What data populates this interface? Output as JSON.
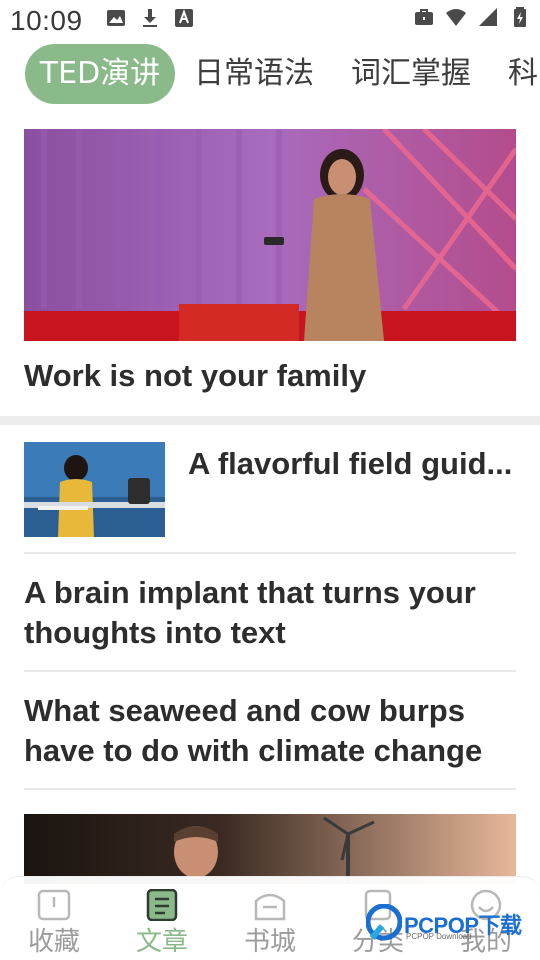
{
  "status_bar": {
    "time": "10:09",
    "left_icons": [
      "image-icon",
      "download-icon",
      "a-box-icon"
    ],
    "right_icons": [
      "briefcase-icon",
      "wifi-icon",
      "signal-icon",
      "battery-icon"
    ]
  },
  "tabs": [
    {
      "label": "TED演讲",
      "active": true
    },
    {
      "label": "日常语法",
      "active": false
    },
    {
      "label": "词汇掌握",
      "active": false
    },
    {
      "label": "科",
      "active": false
    }
  ],
  "feed": {
    "hero": {
      "title": "Work is not your family"
    },
    "thumb_item": {
      "title": "A flavorful field guid..."
    },
    "articles": [
      {
        "title": "A brain implant that turns your thoughts into text"
      },
      {
        "title": "What seaweed and cow burps have to do with climate change"
      }
    ]
  },
  "bottom_nav": [
    {
      "label": "收藏",
      "icon": "book-icon",
      "active": false
    },
    {
      "label": "文章",
      "icon": "article-icon",
      "active": true
    },
    {
      "label": "书城",
      "icon": "bookstore-icon",
      "active": false
    },
    {
      "label": "分类",
      "icon": "category-icon",
      "active": false
    },
    {
      "label": "我的",
      "icon": "profile-icon",
      "active": false
    }
  ],
  "watermark": {
    "text": "PCPOP下载",
    "sub": "PCPOP Download"
  },
  "colors": {
    "accent": "#8ab98a",
    "text": "#2d2d2d",
    "nav_inactive": "#9c9c9c"
  }
}
